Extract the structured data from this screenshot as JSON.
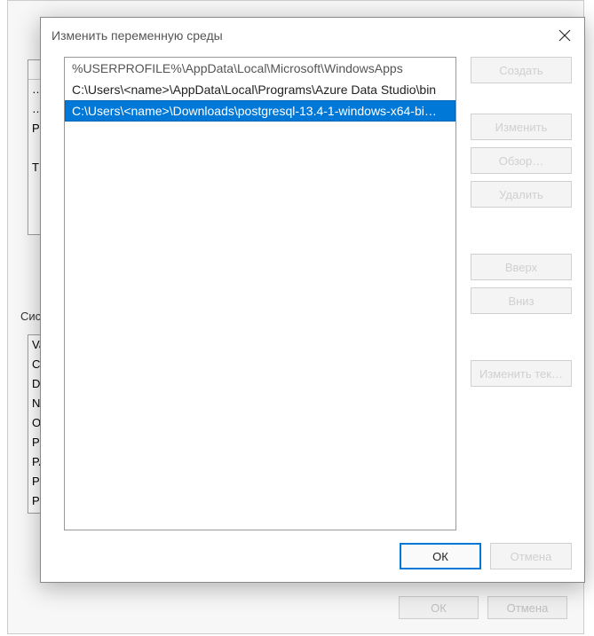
{
  "background_dialog": {
    "user_section_label": "",
    "system_section_label": "Систем…",
    "user_list_partial": [
      "…",
      "…",
      "Pat",
      "",
      "TM"
    ],
    "system_list_partial": [
      "Va",
      "Co",
      "Dri",
      "NU",
      "OS",
      "Pat",
      "PA",
      "PO",
      "PR"
    ],
    "buttons": {
      "ok": "ОК",
      "cancel": "Отмена"
    }
  },
  "modal": {
    "title": "Изменить переменную среды",
    "close_aria": "Close",
    "path_entries": [
      "%USERPROFILE%\\AppData\\Local\\Microsoft\\WindowsApps",
      "C:\\Users\\<name>\\AppData\\Local\\Programs\\Azure Data Studio\\bin"
    ],
    "selected_entry": "C:\\Users\\<name>\\Downloads\\postgresql-13.4-1-windows-x64-bi…",
    "side_buttons": {
      "new": "Создать",
      "edit": "Изменить",
      "browse": "Обзор…",
      "delete": "Удалить",
      "up": "Вверх",
      "down": "Вниз",
      "edit_text": "Изменить тек…"
    },
    "footer": {
      "ok": "ОК",
      "cancel": "Отмена"
    }
  }
}
